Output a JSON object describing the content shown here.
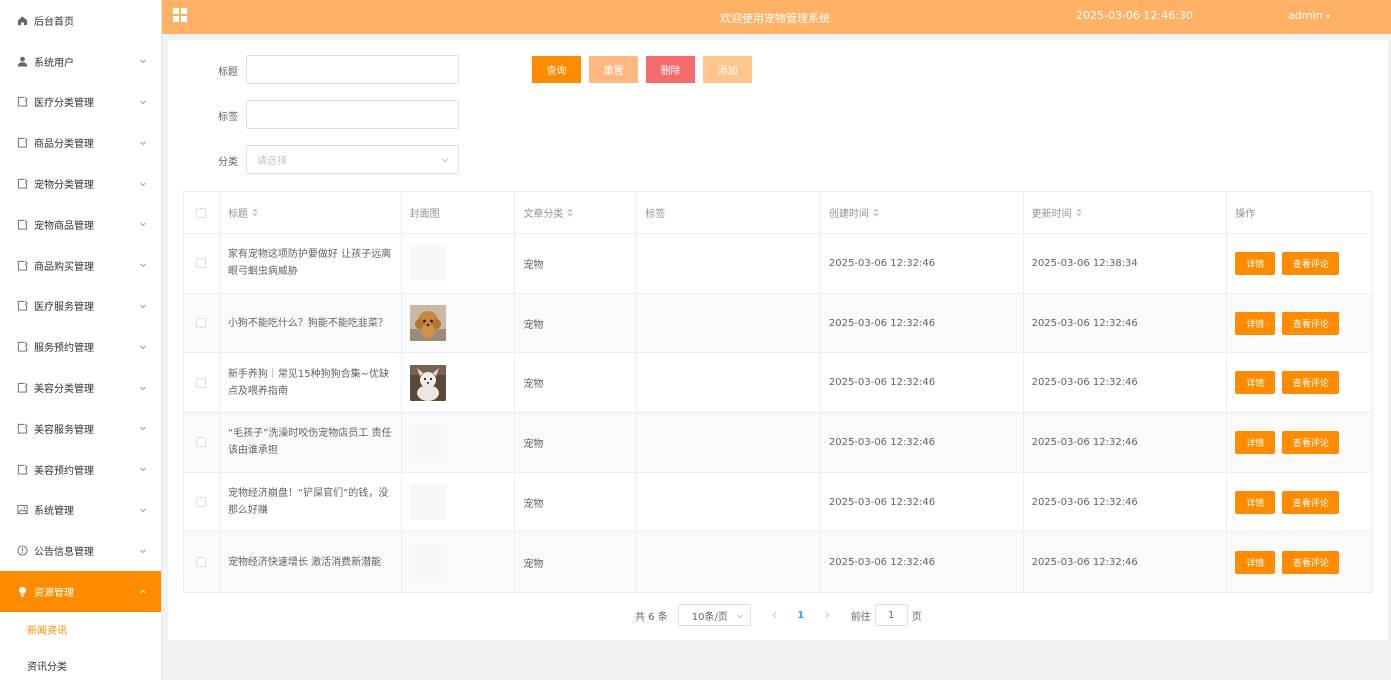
{
  "header": {
    "title": "欢迎使用宠物管理系统",
    "datetime": "2025-03-06 12:46:30",
    "user": "admin"
  },
  "sidebar": {
    "items": [
      {
        "label": "后台首页",
        "icon": "home-icon"
      },
      {
        "label": "系统用户",
        "icon": "user-icon"
      },
      {
        "label": "医疗分类管理",
        "icon": "document-icon"
      },
      {
        "label": "商品分类管理",
        "icon": "document-icon"
      },
      {
        "label": "宠物分类管理",
        "icon": "document-icon"
      },
      {
        "label": "宠物商品管理",
        "icon": "document-icon"
      },
      {
        "label": "商品购买管理",
        "icon": "document-icon"
      },
      {
        "label": "医疗服务管理",
        "icon": "document-icon"
      },
      {
        "label": "服务预约管理",
        "icon": "document-icon"
      },
      {
        "label": "美容分类管理",
        "icon": "document-icon"
      },
      {
        "label": "美容服务管理",
        "icon": "document-icon"
      },
      {
        "label": "美容预约管理",
        "icon": "document-icon"
      },
      {
        "label": "系统管理",
        "icon": "picture-icon"
      },
      {
        "label": "公告信息管理",
        "icon": "info-icon"
      },
      {
        "label": "资源管理",
        "icon": "bulb-icon"
      }
    ],
    "sub_items": [
      "新闻资讯",
      "资讯分类"
    ]
  },
  "search": {
    "title_label": "标题",
    "tag_label": "标签",
    "category_label": "分类",
    "category_placeholder": "请选择",
    "btn_query": "查询",
    "btn_reset": "重置",
    "btn_delete": "删除",
    "btn_add": "添加"
  },
  "colors": {
    "accent": "#ff8c00",
    "header": "#ffb266",
    "reset": "#ffb980",
    "delete": "#f56c6c",
    "add": "#ffc58c"
  },
  "table": {
    "headers": [
      "标题",
      "封面图",
      "文章分类",
      "标签",
      "创建时间",
      "更新时间",
      "操作"
    ],
    "detail_label": "详情",
    "comment_label": "查看评论",
    "rows": [
      {
        "title": "家有宠物这项防护要做好 让孩子远离眼弓蛔虫病威胁",
        "cover": "none",
        "category": "宠物",
        "tag": "",
        "created": "2025-03-06 12:32:46",
        "updated": "2025-03-06 12:38:34"
      },
      {
        "title": "小狗不能吃什么？狗能不能吃韭菜？",
        "cover": "poodle",
        "category": "宠物",
        "tag": "",
        "created": "2025-03-06 12:32:46",
        "updated": "2025-03-06 12:32:46"
      },
      {
        "title": "新手养狗｜常见15种狗狗合集~优缺点及喂养指南",
        "cover": "white-dog",
        "category": "宠物",
        "tag": "",
        "created": "2025-03-06 12:32:46",
        "updated": "2025-03-06 12:32:46"
      },
      {
        "title": "“毛孩子”洗澡时咬伤宠物店员工 责任该由谁承担",
        "cover": "none",
        "category": "宠物",
        "tag": "",
        "created": "2025-03-06 12:32:46",
        "updated": "2025-03-06 12:32:46"
      },
      {
        "title": "宠物经济崩盘！“铲屎官们”的钱，没那么好赚",
        "cover": "none",
        "category": "宠物",
        "tag": "",
        "created": "2025-03-06 12:32:46",
        "updated": "2025-03-06 12:32:46"
      },
      {
        "title": "宠物经济快速增长 激活消费新潜能",
        "cover": "none",
        "category": "宠物",
        "tag": "",
        "created": "2025-03-06 12:32:46",
        "updated": "2025-03-06 12:32:46"
      }
    ]
  },
  "pagination": {
    "total": "共 6 条",
    "page_size": "10条/页",
    "current_page": "1",
    "goto_label": "前往",
    "goto_value": "1",
    "page_unit": "页"
  }
}
